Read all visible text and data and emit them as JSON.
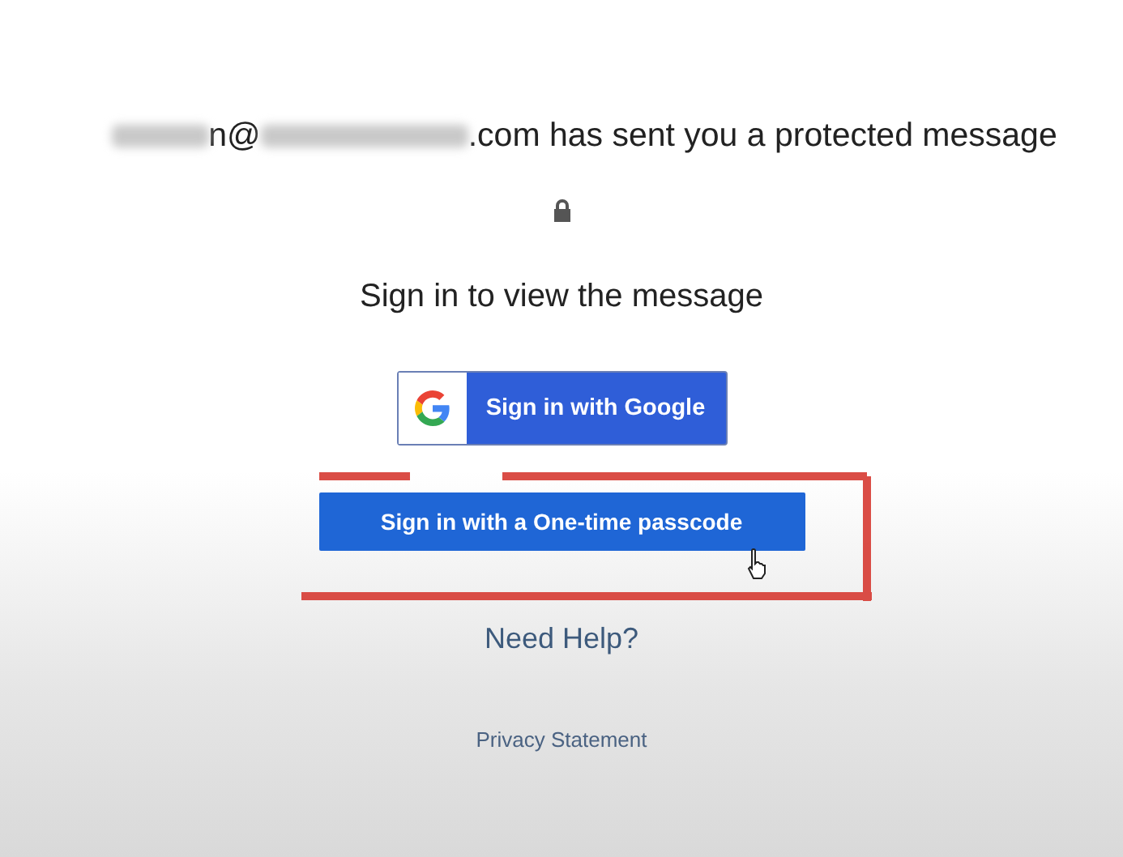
{
  "notice": {
    "local_tail": "n@",
    "text": ".com has sent you a protected message"
  },
  "prompt": "Sign in to view the message",
  "google_button": {
    "label": "Sign in with Google"
  },
  "passcode_button": {
    "label": "Sign in with a One-time passcode"
  },
  "help_link": "Need Help?",
  "privacy_link": "Privacy Statement"
}
